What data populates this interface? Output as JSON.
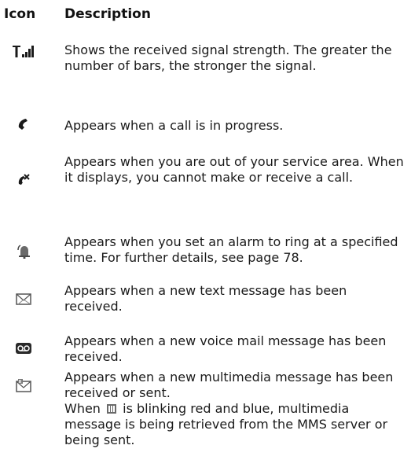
{
  "header": {
    "icon": "Icon",
    "description": "Description"
  },
  "rows": [
    {
      "icon": "signal-strength-icon",
      "lines": [
        "Shows the received signal strength. The greater the number of bars, the stronger the signal."
      ]
    },
    {
      "icon": "call-in-progress-icon",
      "lines": [
        "Appears when a call is in progress."
      ]
    },
    {
      "icon": "no-service-icon",
      "lines": [
        "Appears when you are out of your service area. When it displays, you cannot make or receive a call."
      ]
    },
    {
      "icon": "alarm-bell-icon",
      "lines": [
        "Appears when you set an alarm to ring at a specified time. For further details, see page 78."
      ]
    },
    {
      "icon": "text-message-icon",
      "lines": [
        "Appears when a new text message has been received."
      ]
    },
    {
      "icon": "voice-mail-icon",
      "lines": [
        "Appears when a new voice mail message has been received."
      ]
    },
    {
      "icon": "multimedia-message-icon",
      "lines": [
        "Appears when a new multimedia message has been received or sent."
      ],
      "extra": {
        "before": "When",
        "inline_icon": "mms-retrieving-icon",
        "after": "is blinking red and blue, multimedia message is being retrieved from the MMS server or being sent."
      }
    }
  ]
}
